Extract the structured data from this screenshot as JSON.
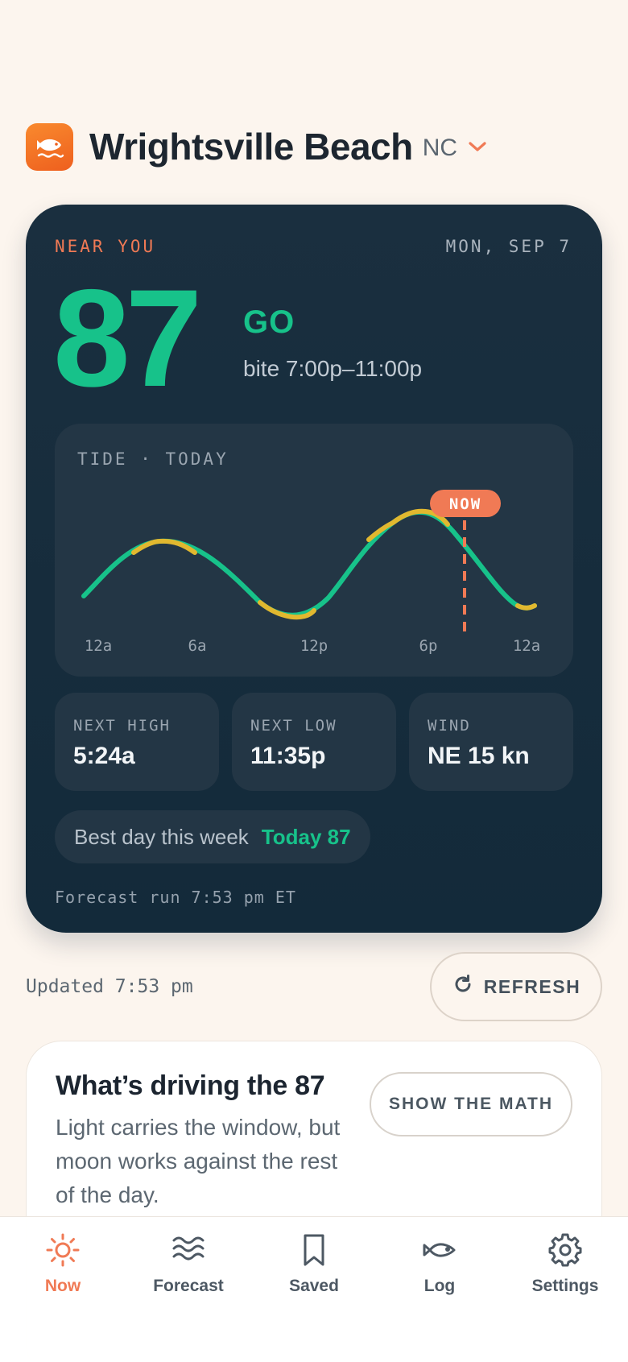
{
  "header": {
    "location": "Wrightsville Beach",
    "state": "NC"
  },
  "card": {
    "near_label": "NEAR YOU",
    "date": "MON, SEP 7",
    "score": "87",
    "verdict": "GO",
    "bite_window": "bite 7:00p–11:00p",
    "tide": {
      "title": "TIDE · TODAY",
      "now_label": "NOW",
      "ticks": [
        "12a",
        "6a",
        "12p",
        "6p",
        "12a"
      ],
      "chart_data": {
        "type": "line",
        "x": [
          "12a",
          "6a",
          "12p",
          "6p",
          "12a"
        ],
        "series_curve": "tide height",
        "high_times": [
          "~4a",
          "~6p"
        ],
        "low_times": [
          "~11a",
          "~11p"
        ],
        "now_position": "~8p"
      }
    },
    "stats": [
      {
        "label": "NEXT HIGH",
        "value": "5:24a"
      },
      {
        "label": "NEXT LOW",
        "value": "11:35p"
      },
      {
        "label": "WIND",
        "value": "NE 15 kn"
      }
    ],
    "best_day": {
      "label": "Best day this week",
      "value": "Today 87"
    },
    "forecast_run": "Forecast run 7:53 pm ET"
  },
  "updated": "Updated 7:53 pm",
  "refresh_label": "REFRESH",
  "driver": {
    "title": "What’s driving the 87",
    "desc": "Light carries the window, but moon works against the rest of the day.",
    "button": "SHOW THE MATH"
  },
  "tabs": [
    {
      "label": "Now",
      "icon": "sun-icon"
    },
    {
      "label": "Forecast",
      "icon": "waves-icon"
    },
    {
      "label": "Saved",
      "icon": "bookmark-icon"
    },
    {
      "label": "Log",
      "icon": "fish-icon"
    },
    {
      "label": "Settings",
      "icon": "gear-icon"
    }
  ],
  "colors": {
    "accent": "#f07a55",
    "go_green": "#17c28a",
    "card_bg": "#1a2f3f",
    "tide_yellow": "#e1b82f"
  }
}
